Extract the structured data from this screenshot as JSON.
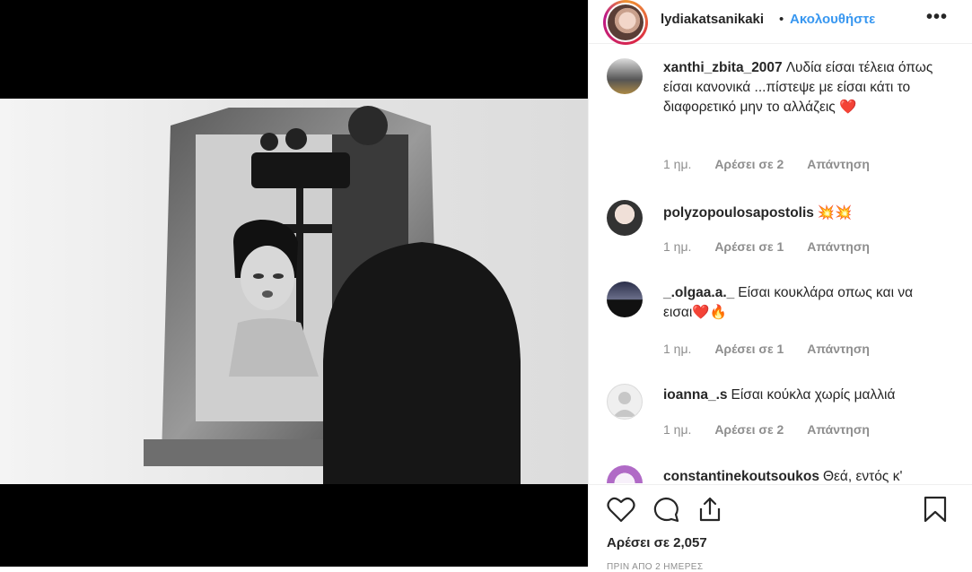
{
  "post": {
    "username": "lydiakatsanikaki",
    "dot": "•",
    "follow_label": "Ακολουθήστε",
    "more_label": "•••",
    "likes_text": "Αρέσει σε 2,057",
    "date_text": "ΠΡΙΝ ΑΠΟ 2 ΗΜΕΡΕΣ"
  },
  "comments": [
    {
      "user": "xanthi_zbita_2007",
      "text": "Λυδία είσαι τέλεια όπως είσαι κανονικά ...πίστεψε με είσαι κάτι το διαφορετικό μην το αλλάζεις ❤️",
      "time": "1 ημ.",
      "likes": "Αρέσει σε 2",
      "reply": "Απάντηση"
    },
    {
      "user": "polyzopoulosapostolis",
      "text": "💥💥",
      "time": "1 ημ.",
      "likes": "Αρέσει σε 1",
      "reply": "Απάντηση"
    },
    {
      "user": "_.olgaa.a._",
      "text": "Είσαι κουκλάρα οπως και να εισαι❤️🔥",
      "time": "1 ημ.",
      "likes": "Αρέσει σε 1",
      "reply": "Απάντηση"
    },
    {
      "user": "ioanna_.s",
      "text": "Είσαι κούκλα χωρίς μαλλιά",
      "time": "1 ημ.",
      "likes": "Αρέσει σε 2",
      "reply": "Απάντηση"
    },
    {
      "user": "constantinekoutsoukos",
      "text": "Θεά, εντός κ'",
      "time": "",
      "likes": "",
      "reply": ""
    }
  ],
  "colors": {
    "accent": "#3897f0",
    "muted": "#8e8e8e",
    "text": "#262626"
  },
  "icons": [
    "heart-icon",
    "comment-icon",
    "share-icon",
    "bookmark-icon"
  ]
}
